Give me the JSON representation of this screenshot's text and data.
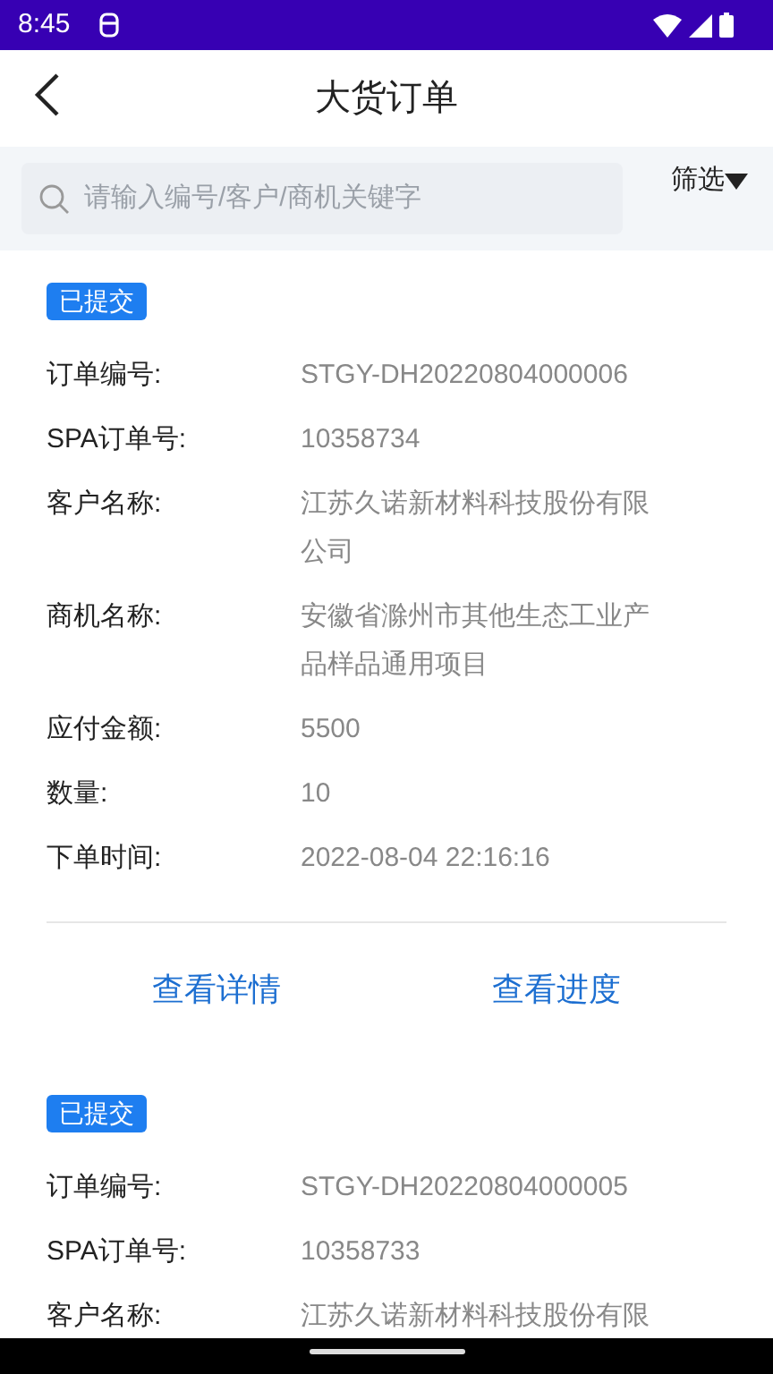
{
  "status_bar": {
    "time": "8:45"
  },
  "header": {
    "title": "大货订单"
  },
  "search": {
    "placeholder": "请输入编号/客户/商机关键字",
    "filter": "筛选"
  },
  "orders": [
    {
      "status": "已提交",
      "fields": [
        {
          "label": "订单编号:",
          "value": "STGY-DH20220804000006"
        },
        {
          "label": "SPA订单号:",
          "value": "10358734"
        },
        {
          "label": "客户名称:",
          "value": "江苏久诺新材料科技股份有限公司"
        },
        {
          "label": "商机名称:",
          "value": "安徽省滁州市其他生态工业产品样品通用项目"
        },
        {
          "label": "应付金额:",
          "value": "5500"
        },
        {
          "label": "数量:",
          "value": "10"
        },
        {
          "label": "下单时间:",
          "value": "2022-08-04 22:16:16"
        }
      ],
      "actions": [
        "查看详情",
        "查看进度"
      ]
    },
    {
      "status": "已提交",
      "fields": [
        {
          "label": "订单编号:",
          "value": "STGY-DH20220804000005"
        },
        {
          "label": "SPA订单号:",
          "value": "10358733"
        },
        {
          "label": "客户名称:",
          "value": "江苏久诺新材料科技股份有限"
        }
      ]
    }
  ]
}
